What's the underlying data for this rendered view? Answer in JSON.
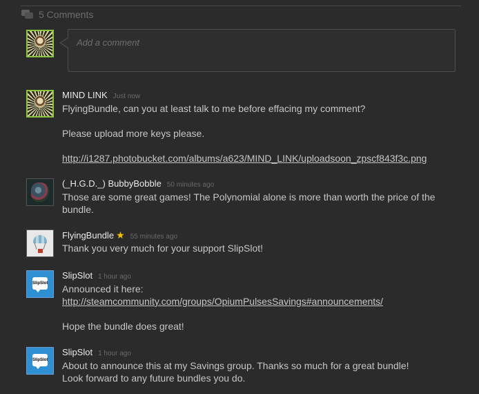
{
  "header": {
    "count_label": "5 Comments"
  },
  "composer": {
    "placeholder": "Add a comment"
  },
  "comments": [
    {
      "author": "MIND LINK",
      "time": "Just now",
      "lines": [
        "FlyingBundle, can you at least talk to me before effacing my comment?",
        "Please upload more keys please."
      ],
      "link": "http://i1287.photobucket.com/albums/a623/MIND_LINK/uploadsoon_zpscf843f3c.png"
    },
    {
      "author": "(_H.G.D._) BubbyBobble",
      "time": "50 minutes ago",
      "lines": [
        "Those are some great games! The Polynomial alone is more than worth the price of the",
        "bundle."
      ]
    },
    {
      "author": "FlyingBundle",
      "time": "55 minutes ago",
      "lines": [
        "Thank you very much for your support SlipSlot!"
      ]
    },
    {
      "author": "SlipSlot",
      "time": "1 hour ago",
      "lines": [
        "Announced it here:",
        "Hope the bundle does great!"
      ],
      "link": "http://steamcommunity.com/groups/OpiumPulsesSavings#announcements/"
    },
    {
      "author": "SlipSlot",
      "time": "1 hour ago",
      "lines": [
        "About to announce this at my Savings group. Thanks so much for a great bundle!",
        "Look forward to any future bundles you do."
      ]
    }
  ],
  "avatar_labels": {
    "slipslot": "SlipSlot"
  },
  "icons": {
    "header": "comments-icon",
    "moderator": "star-icon"
  },
  "colors": {
    "background": "#2b2b2b",
    "star": "#f2c200",
    "avatar_border_online": "#8bc53f"
  }
}
